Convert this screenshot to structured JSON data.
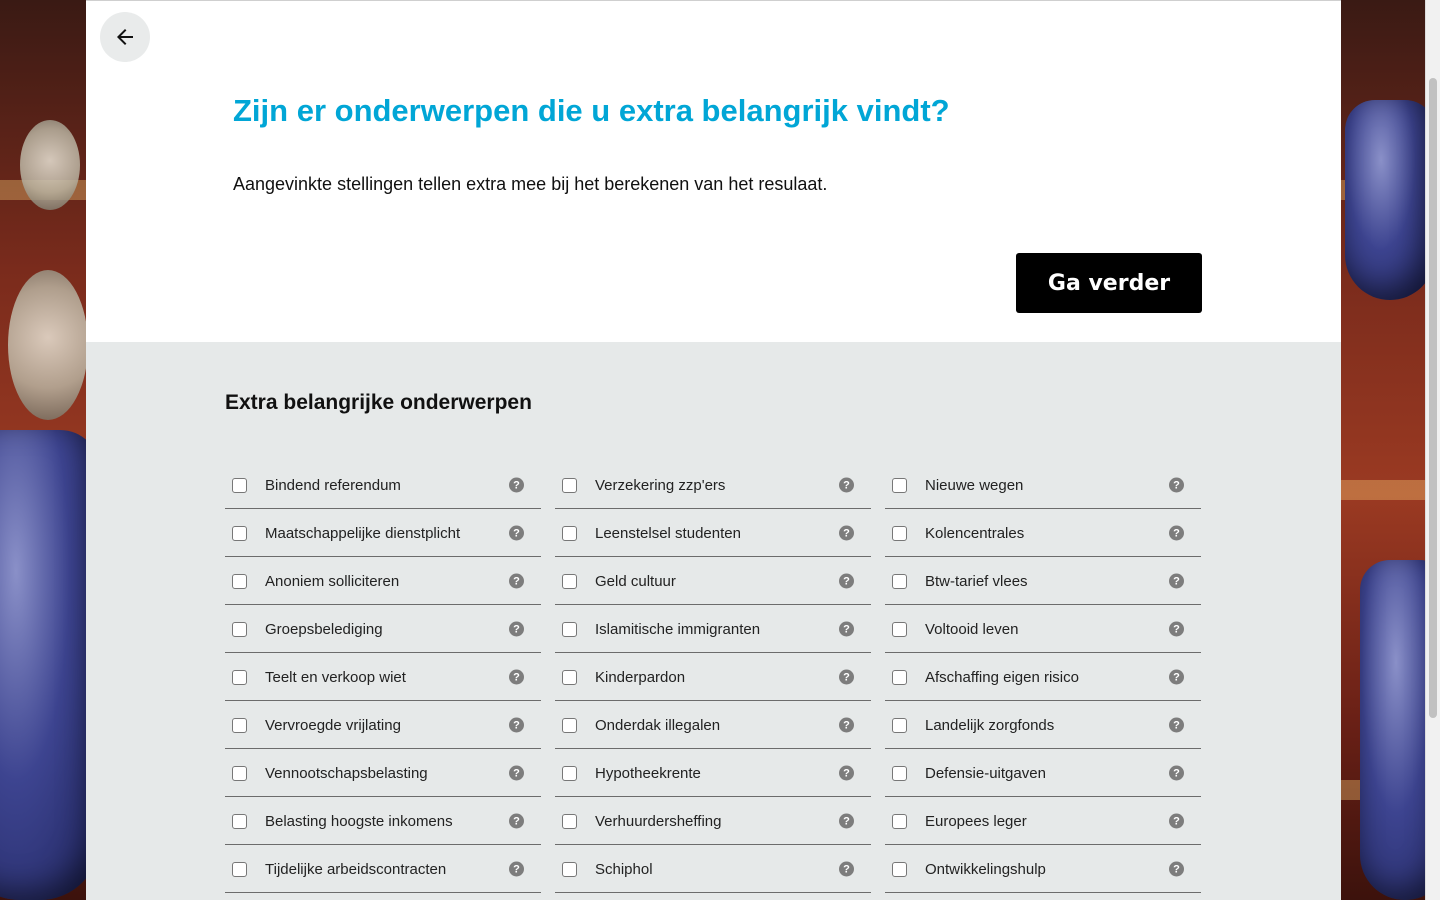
{
  "header": {
    "back_icon": "arrow-left-icon",
    "title": "Zijn er onderwerpen die u extra belangrijk vindt?",
    "subtitle": "Aangevinkte stellingen tellen extra mee bij het berekenen van het resulaat.",
    "continue_label": "Ga verder"
  },
  "section": {
    "title": "Extra belangrijke onderwerpen",
    "help_glyph": "?",
    "columns": [
      [
        "Bindend referendum",
        "Maatschappelijke dienstplicht",
        "Anoniem solliciteren",
        "Groepsbelediging",
        "Teelt en verkoop wiet",
        "Vervroegde vrijlating",
        "Vennootschapsbelasting",
        "Belasting hoogste inkomens",
        "Tijdelijke arbeidscontracten"
      ],
      [
        "Verzekering zzp'ers",
        "Leenstelsel studenten",
        "Geld cultuur",
        "Islamitische immigranten",
        "Kinderpardon",
        "Onderdak illegalen",
        "Hypotheekrente",
        "Verhuurdersheffing",
        "Schiphol"
      ],
      [
        "Nieuwe wegen",
        "Kolencentrales",
        "Btw-tarief vlees",
        "Voltooid leven",
        "Afschaffing eigen risico",
        "Landelijk zorgfonds",
        "Defensie-uitgaven",
        "Europees leger",
        "Ontwikkelingshulp"
      ]
    ]
  },
  "colors": {
    "title": "#01a6d6",
    "button_bg": "#000000",
    "section_bg": "#e6e9e9"
  }
}
